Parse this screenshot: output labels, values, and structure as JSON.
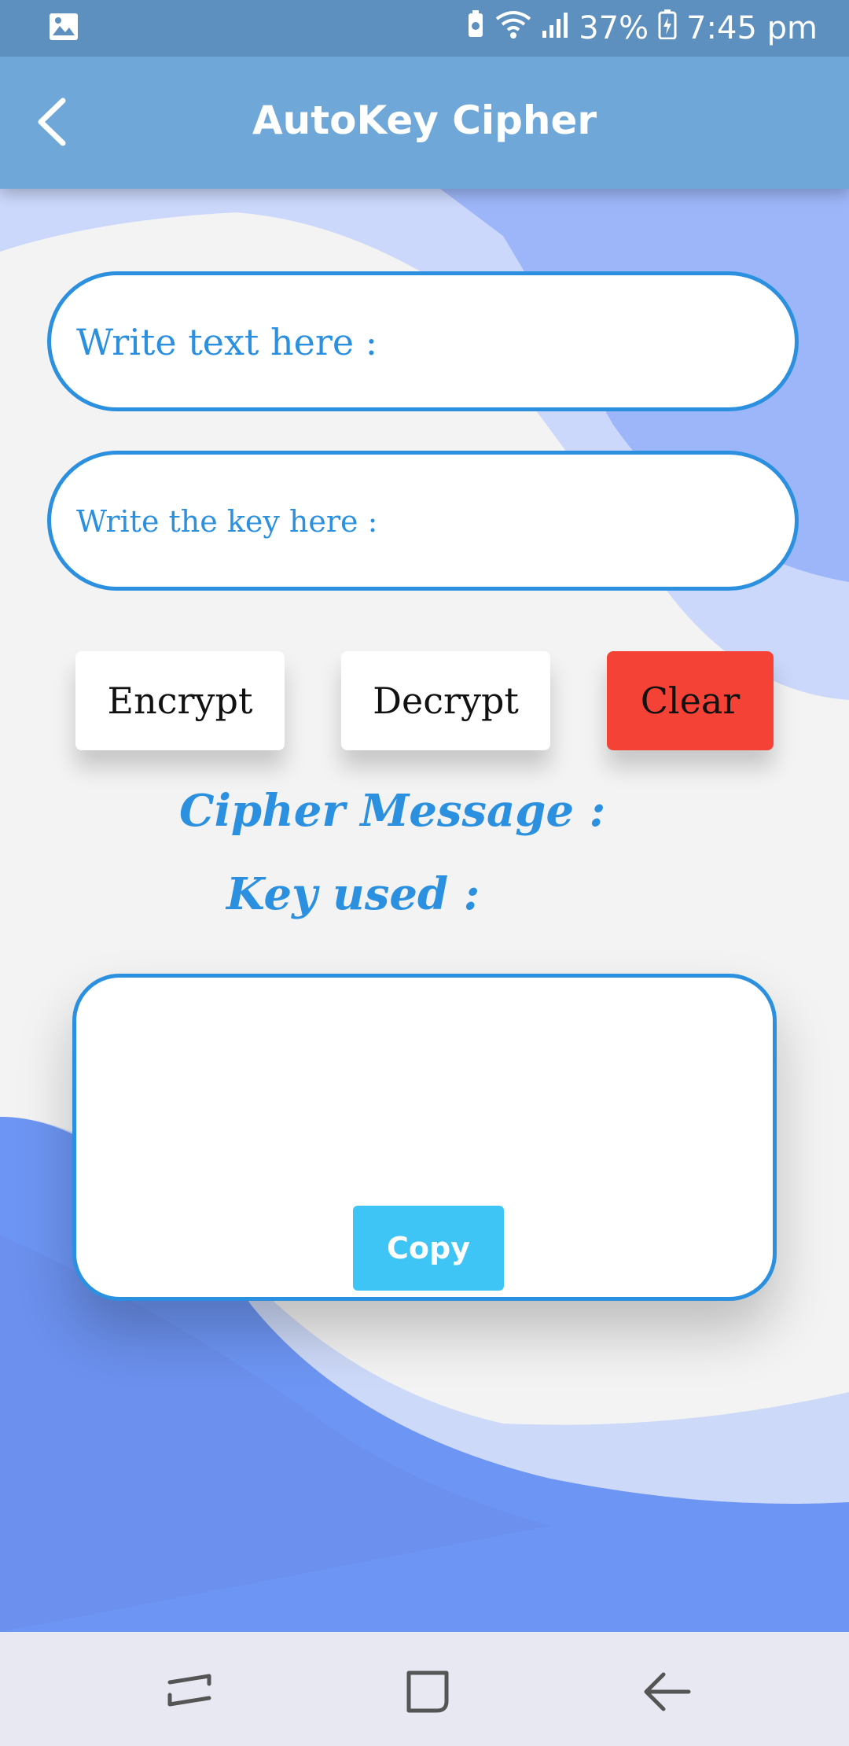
{
  "status_bar": {
    "left_icon": "image-icon",
    "battery": "37%",
    "time": "7:45 pm"
  },
  "app_bar": {
    "title": "AutoKey Cipher",
    "back_icon": "chevron-left-icon"
  },
  "form": {
    "text_placeholder": "Write text here :",
    "text_value": "",
    "key_placeholder": "Write the key here :",
    "key_value": ""
  },
  "actions": {
    "encrypt_label": "Encrypt",
    "decrypt_label": "Decrypt",
    "clear_label": "Clear"
  },
  "result": {
    "cipher_label": "Cipher Message :",
    "key_label": "Key used :",
    "copy_label": "Copy"
  },
  "nav_bar": {
    "items": [
      "recent-apps-icon",
      "home-icon",
      "back-icon"
    ]
  },
  "colors": {
    "accent": "#2b90e0",
    "app_bar": "#6fa8d8",
    "status_bar": "#5d8fbf",
    "clear_button": "#f44336",
    "copy_button": "#3fc4f6"
  }
}
